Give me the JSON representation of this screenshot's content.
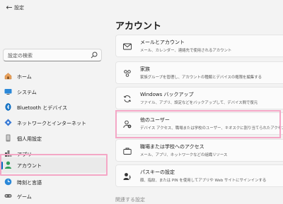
{
  "app": {
    "title": "設定"
  },
  "search": {
    "placeholder": "設定の検索"
  },
  "nav": [
    {
      "label": "ホーム"
    },
    {
      "label": "システム"
    },
    {
      "label": "Bluetooth とデバイス"
    },
    {
      "label": "ネットワークとインターネット"
    },
    {
      "label": "個人用設定"
    },
    {
      "label": "アプリ"
    },
    {
      "label": "アカウント"
    },
    {
      "label": "時刻と言語"
    },
    {
      "label": "ゲーム"
    }
  ],
  "main": {
    "title": "アカウント",
    "cards": [
      {
        "title": "メールとアカウント",
        "desc": "メール、カレンダー、連絡先で使用されるアカウント"
      },
      {
        "title": "家族",
        "desc": "家族グループを管理し、アカウントの種類とデバイスの権限を編集する"
      },
      {
        "title": "Windows バックアップ",
        "desc": "ファイル、アプリ、設定などをバックアップして、デバイス間で復元"
      },
      {
        "title": "他のユーザー",
        "desc": "デバイス アクセス、職場または学校のユーザー、キオスクに割り当てられたアクセス"
      },
      {
        "title": "職場または学校へのアクセス",
        "desc": "メール、アプリ、ネットワークなどの組織リソース"
      },
      {
        "title": "パスキーの設定",
        "desc": "顔、指紋、または PIN を使用してアプリや Web サイトにサインインする"
      }
    ],
    "section_peek": "関連する設定"
  },
  "colors": {
    "accent": "#0067c0",
    "highlight": "#f4a7c6"
  }
}
